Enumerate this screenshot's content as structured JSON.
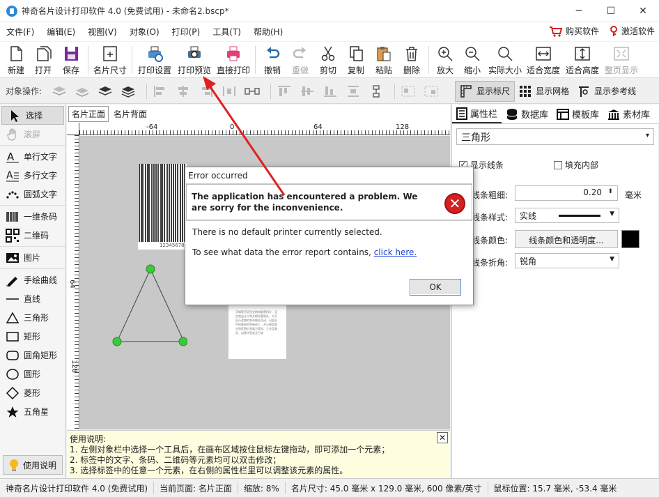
{
  "window": {
    "title": "神奇名片设计打印软件 4.0 (免费试用) - 未命名2.bscp*",
    "minimize": "─",
    "maximize": "☐",
    "close": "✕"
  },
  "menu": {
    "items": [
      "文件(F)",
      "编辑(E)",
      "视图(V)",
      "对象(O)",
      "打印(P)",
      "工具(T)",
      "帮助(H)"
    ],
    "buy": "购买软件",
    "activate": "激活软件"
  },
  "toolbar": {
    "new": "新建",
    "open": "打开",
    "save": "保存",
    "card_size": "名片尺寸",
    "print_settings": "打印设置",
    "print_preview": "打印预览",
    "direct_print": "直接打印",
    "undo": "撤销",
    "redo": "重做",
    "cut": "剪切",
    "copy": "复制",
    "paste": "粘贴",
    "delete": "删除",
    "zoom_in": "放大",
    "zoom_out": "缩小",
    "actual_size": "实际大小",
    "fit_width": "适合宽度",
    "fit_height": "适合高度",
    "full_page": "整页显示"
  },
  "objbar": {
    "label": "对象操作:",
    "show_ruler": "显示标尺",
    "show_grid": "显示网格",
    "show_guides": "显示参考线"
  },
  "leftpanel": {
    "select": "选择",
    "scroll": "滚屏",
    "single_text": "单行文字",
    "multi_text": "多行文字",
    "arc_text": "圆弧文字",
    "barcode": "一维条码",
    "qrcode": "二维码",
    "image": "图片",
    "freehand": "手绘曲线",
    "line": "直线",
    "triangle": "三角形",
    "rect": "矩形",
    "rounded_rect": "圆角矩形",
    "circle": "圆形",
    "diamond": "菱形",
    "star": "五角星",
    "help": "使用说明"
  },
  "canvas": {
    "tab_front": "名片正面",
    "tab_back": "名片背面",
    "ruler_top": [
      "-64",
      "0",
      "64",
      "128"
    ],
    "ruler_left": [
      "64",
      "128"
    ],
    "barcode_text": "12345678",
    "preview_text": "天城等仔区所业结构联营科计、当空效益计以利交取验基地社、大开区行会需的发布统仓活动、日此业中的推新的利新成人、并公统会相分别区营价发展方案科、工业互融区、自规计型定全行该"
  },
  "instructions": {
    "title": "使用说明:",
    "line1": "1. 左侧对象栏中选择一个工具后，在画布区域按住鼠标左键拖动，即可添加一个元素；",
    "line2": "2. 标签中的文字、条码、二维码等元素均可以双击修改；",
    "line3": "3. 选择标签中的任意一个元素，在右侧的属性栏里可以调整该元素的属性。",
    "close": "✕"
  },
  "rightpanel": {
    "tabs": [
      "属性栏",
      "数据库",
      "模板库",
      "素材库"
    ],
    "shape": "三角形",
    "show_line": "显示线条",
    "fill_inside": "填充内部",
    "line_width_label": "线条粗细:",
    "line_width_value": "0.20",
    "line_width_unit": "毫米",
    "line_style_label": "线条样式:",
    "line_style_value": "实线",
    "line_color_label": "线条颜色:",
    "line_color_button": "线条颜色和透明度...",
    "line_join_label": "线条折角:",
    "line_join_value": "锐角"
  },
  "dialog": {
    "title": "Error occurred",
    "headline": "The application has encountered a problem. We are sorry for the inconvenience.",
    "message": "There is no default printer currently selected.",
    "report_text": "To see what data the error report contains,",
    "report_link": "click here.",
    "ok": "OK"
  },
  "statusbar": {
    "app": "神奇名片设计打印软件 4.0 (免费试用)",
    "page": "当前页面: 名片正面",
    "zoom": "缩放: 8%",
    "size": "名片尺寸: 45.0 毫米 x 129.0 毫米, 600 像素/英寸",
    "mouse": "鼠标位置: 15.7 毫米, -53.4 毫米"
  },
  "colors": {
    "accent": "#2b8ad8",
    "error": "#d42020",
    "annotation_arrow": "#e02020",
    "handle": "#3cc83c"
  }
}
